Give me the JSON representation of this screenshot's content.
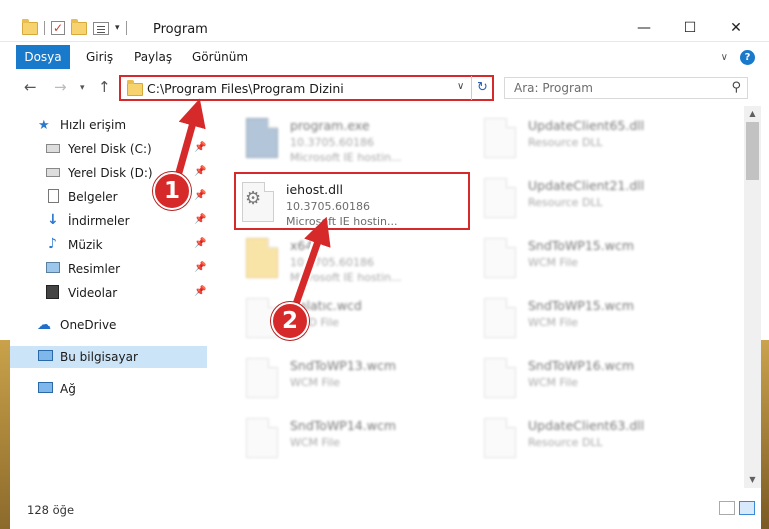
{
  "window": {
    "title": "Program",
    "minimize": "—",
    "maximize": "☐",
    "close": "✕"
  },
  "ribbon": {
    "tabs": [
      "Dosya",
      "Giriş",
      "Paylaş",
      "Görünüm"
    ],
    "help": "?"
  },
  "address": {
    "path": "C:\\Program Files\\Program Dizini",
    "search_placeholder": "Ara: Program"
  },
  "sidebar": {
    "quick_access": "Hızlı erişim",
    "items": [
      {
        "label": "Yerel Disk (C:)",
        "pinned": true
      },
      {
        "label": "Yerel Disk (D:)",
        "pinned": true
      },
      {
        "label": "Belgeler",
        "pinned": true
      },
      {
        "label": "İndirmeler",
        "pinned": true
      },
      {
        "label": "Müzik",
        "pinned": true
      },
      {
        "label": "Resimler",
        "pinned": true
      },
      {
        "label": "Videolar",
        "pinned": true
      }
    ],
    "onedrive": "OneDrive",
    "this_pc": "Bu bilgisayar",
    "network": "Ağ"
  },
  "files": [
    {
      "name": "program.exe",
      "line2": "10.3705.60186",
      "line3": "Microsoft IE hostin...",
      "blurred": true,
      "kind": "exe"
    },
    {
      "name": "UpdateClient65.dll",
      "line2": "Resource DLL",
      "line3": "",
      "blurred": true,
      "kind": "file"
    },
    {
      "name": "iehost.dll",
      "line2": "10.3705.60186",
      "line3": "Microsoft IE hostin...",
      "blurred": false,
      "kind": "dll"
    },
    {
      "name": "UpdateClient21.dll",
      "line2": "Resource DLL",
      "line3": "",
      "blurred": true,
      "kind": "file"
    },
    {
      "name": "x64",
      "line2": "10.3705.60186",
      "line3": "Microsoft IE hostin...",
      "blurred": true,
      "kind": "folder"
    },
    {
      "name": "SndToWP15.wcm",
      "line2": "WCM File",
      "line3": "",
      "blurred": true,
      "kind": "file"
    },
    {
      "name": "Anlatıc.wcd",
      "line2": "WCD File",
      "line3": "",
      "blurred": true,
      "kind": "file"
    },
    {
      "name": "SndToWP15.wcm",
      "line2": "WCM File",
      "line3": "",
      "blurred": true,
      "kind": "file"
    },
    {
      "name": "SndToWP13.wcm",
      "line2": "WCM File",
      "line3": "",
      "blurred": true,
      "kind": "file"
    },
    {
      "name": "SndToWP16.wcm",
      "line2": "WCM File",
      "line3": "",
      "blurred": true,
      "kind": "file"
    },
    {
      "name": "SndToWP14.wcm",
      "line2": "WCM File",
      "line3": "",
      "blurred": true,
      "kind": "file"
    },
    {
      "name": "UpdateClient63.dll",
      "line2": "Resource DLL",
      "line3": "",
      "blurred": true,
      "kind": "file"
    }
  ],
  "status": {
    "item_count": "128 öğe"
  },
  "annotations": {
    "step1": "1",
    "step2": "2",
    "color": "#d62a2a"
  }
}
